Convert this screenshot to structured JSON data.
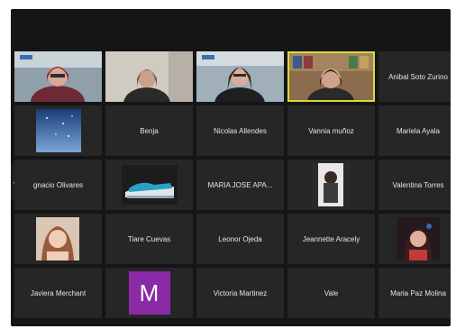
{
  "participants": {
    "p0": {
      "name": "",
      "video": true
    },
    "p1": {
      "name": "",
      "video": true
    },
    "p2": {
      "name": "",
      "video": true
    },
    "p3": {
      "name": "",
      "video": true,
      "active_speaker": true
    },
    "p4": {
      "name": "Anibal Soto Zurino"
    },
    "p5": {
      "name": "",
      "video": true
    },
    "p6": {
      "name": "Benja"
    },
    "p7": {
      "name": "Nicolas Allendes"
    },
    "p8": {
      "name": "Vannia muñoz"
    },
    "p9": {
      "name": "Mariela Ayala"
    },
    "p10": {
      "name": "gnacio Olivares"
    },
    "p11": {
      "name": "",
      "video": true
    },
    "p12": {
      "name": "MARIA JOSE APA..."
    },
    "p13": {
      "name": "",
      "video": true
    },
    "p14": {
      "name": "Valentina Torres"
    },
    "p15": {
      "name": "",
      "video": true
    },
    "p16": {
      "name": "Tiare Cuevas"
    },
    "p17": {
      "name": "Leonor Ojeda"
    },
    "p18": {
      "name": "Jeannette Aracely"
    },
    "p19": {
      "name": "",
      "video": true
    },
    "p20": {
      "name": "Javiera Merchant"
    },
    "p21": {
      "name": "",
      "avatar_initial": "M",
      "avatar_color": "#8a2aa6"
    },
    "p22": {
      "name": "Victoria Martinez"
    },
    "p23": {
      "name": "Vale"
    },
    "p24": {
      "name": "Maria Paz Molina"
    }
  },
  "nav": {
    "prev_icon": "chevron-left-icon",
    "next_icon": "chevron-right-icon"
  },
  "colors": {
    "background": "#151515",
    "tile": "#262626",
    "active_border": "#d9d93a"
  }
}
